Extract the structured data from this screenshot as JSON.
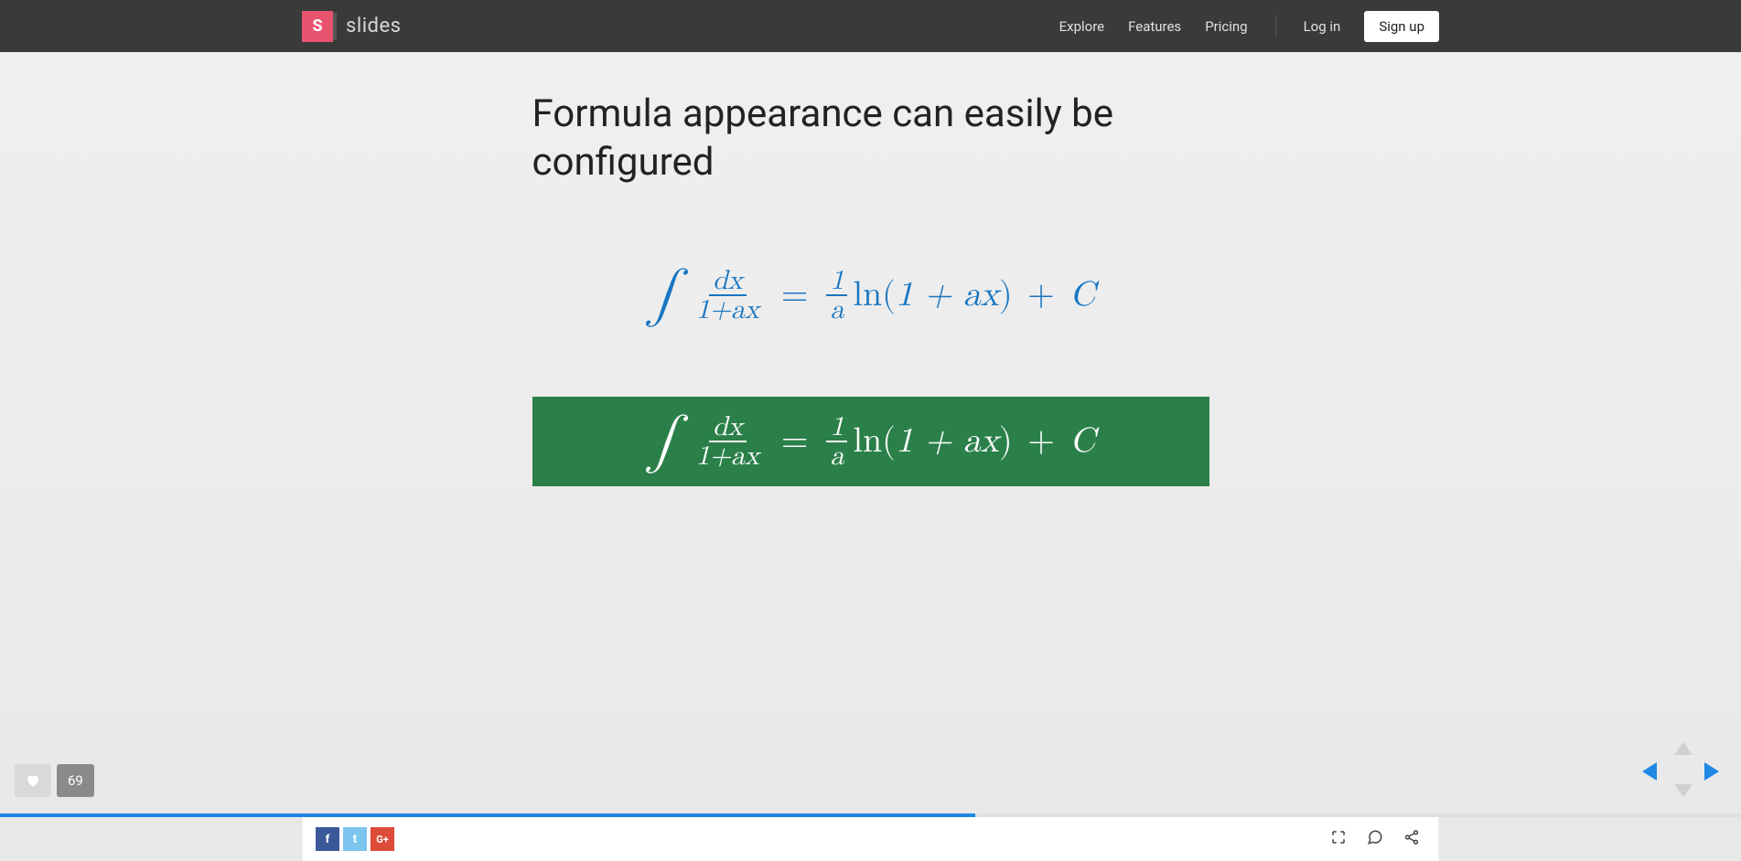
{
  "header": {
    "logo_letter": "S",
    "logo_text": "slides",
    "nav": {
      "explore": "Explore",
      "features": "Features",
      "pricing": "Pricing",
      "login": "Log in",
      "signup": "Sign up"
    }
  },
  "slide": {
    "title": "Formula appearance can easily be configured",
    "formula_blue": {
      "integral": "∫",
      "frac_num": "dx",
      "frac_den": "1+ax",
      "equals": "=",
      "frac2_num": "1",
      "frac2_den": "a",
      "ln": "ln",
      "lparen": "(",
      "inner": "1 + ax",
      "rparen": ")",
      "plus": "+",
      "const": "C"
    },
    "formula_green": {
      "integral": "∫",
      "frac_num": "dx",
      "frac_den": "1+ax",
      "equals": "=",
      "frac2_num": "1",
      "frac2_den": "a",
      "ln": "ln",
      "lparen": "(",
      "inner": "1 + ax",
      "rparen": ")",
      "plus": "+",
      "const": "C"
    }
  },
  "likes": {
    "count": "69"
  },
  "progress": {
    "percent": 56
  },
  "social": {
    "fb": "f",
    "tw": "t",
    "gp": "G+"
  },
  "colors": {
    "accent": "#1e88e5",
    "brand": "#e8536f",
    "formula_bg": "#2b8049"
  }
}
